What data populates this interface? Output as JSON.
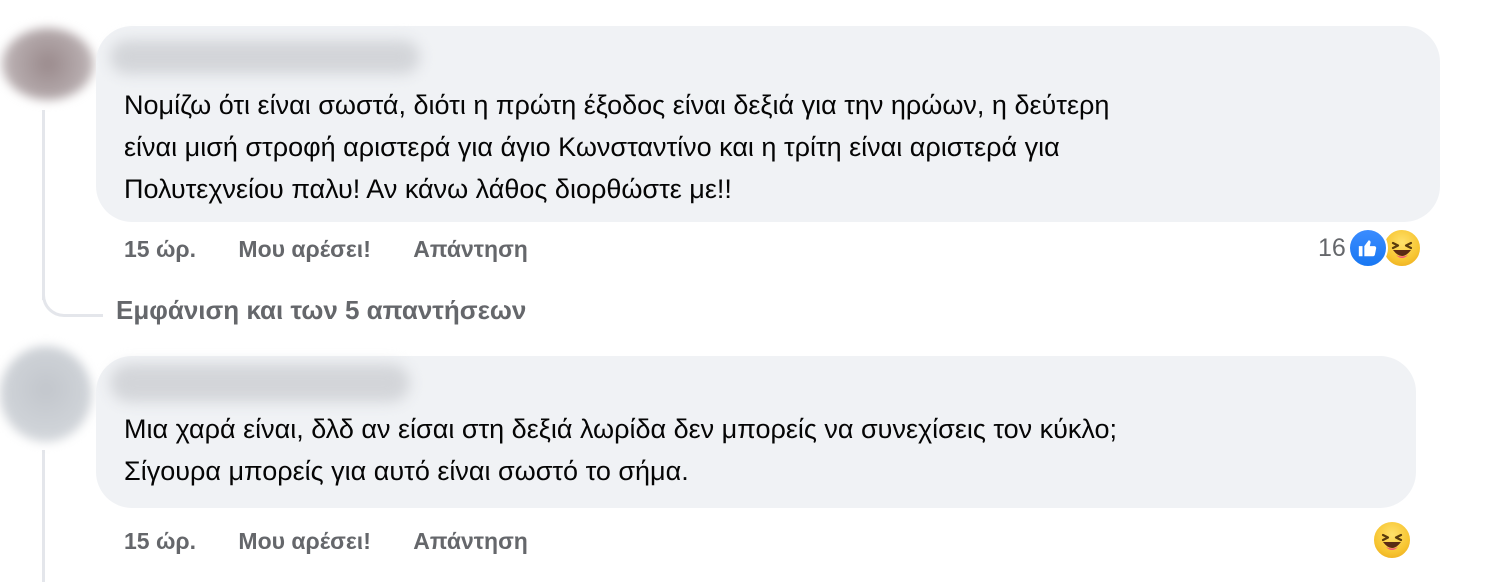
{
  "comments": [
    {
      "lines": [
        "Νομίζω ότι είναι σωστά, διότι η πρώτη έξοδος είναι δεξιά για την ηρώων, η δεύτερη",
        "είναι μισή στροφή αριστερά για άγιο Κωνσταντίνο και η τρίτη είναι αριστερά για",
        "Πολυτεχνείου παλυ! Αν κάνω λάθος διορθώστε με!!"
      ],
      "time": "15 ώρ.",
      "like_label": "Μου αρέσει!",
      "reply_label": "Απάντηση",
      "reaction_count": "16",
      "reaction_icons": [
        "like-icon",
        "haha-icon"
      ]
    },
    {
      "lines": [
        "Μια χαρά είναι, δλδ αν είσαι στη δεξιά λωρίδα δεν μπορείς να συνεχίσεις τον κύκλο;",
        "Σίγουρα μπορείς για αυτό είναι σωστό το σήμα."
      ],
      "time": "15 ώρ.",
      "like_label": "Μου αρέσει!",
      "reply_label": "Απάντηση",
      "reaction_icons": [
        "haha-icon"
      ]
    }
  ],
  "view_replies_label": "Εμφάνιση και των 5 απαντήσεων",
  "colors": {
    "bubble": "#f0f2f5",
    "secondary_text": "#65676b",
    "like_blue": "#1877f2",
    "haha_yellow": "#f7c531"
  }
}
